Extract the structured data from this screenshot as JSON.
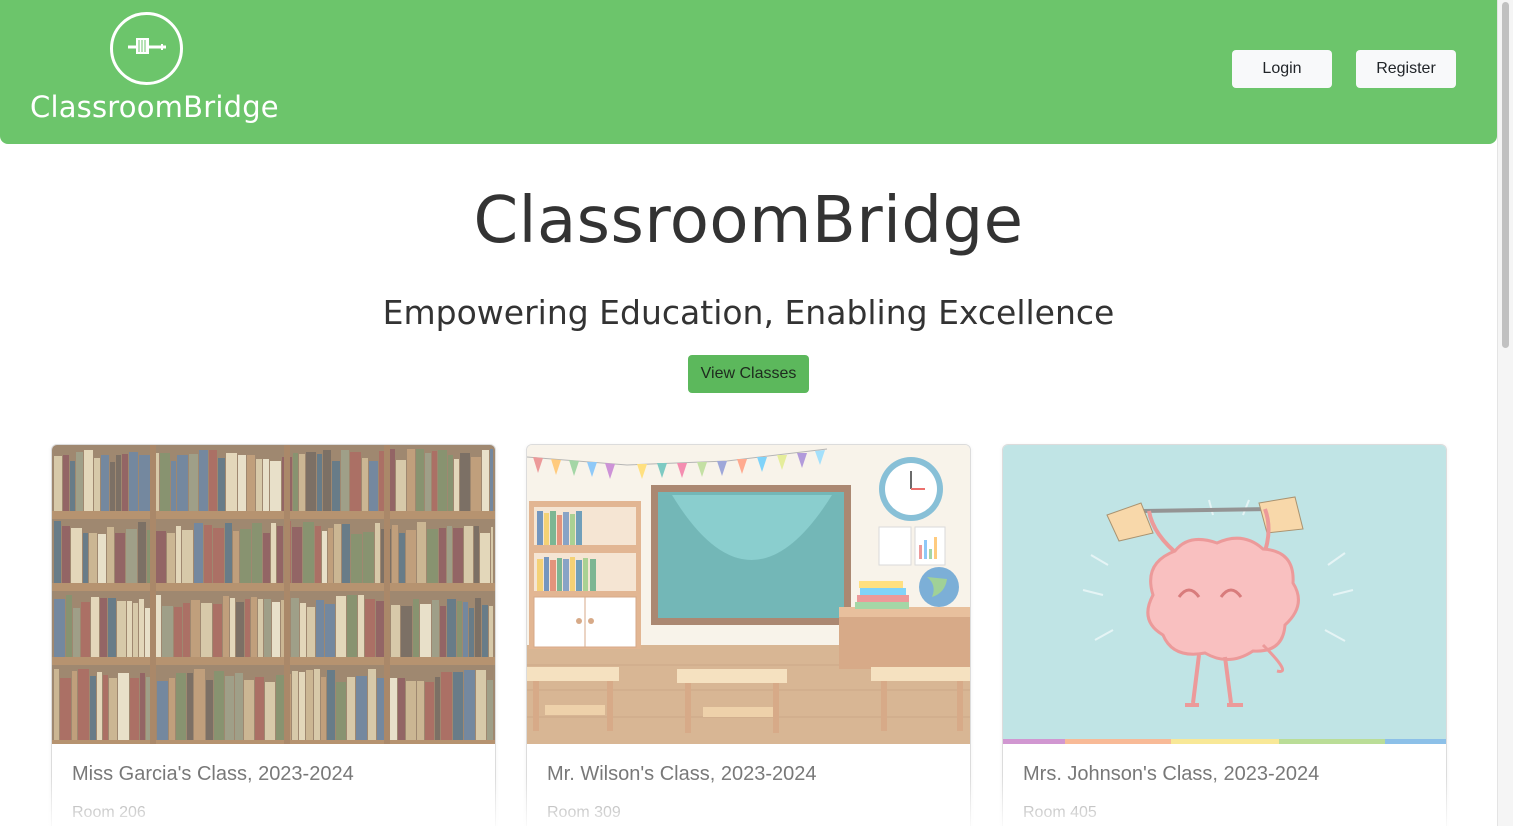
{
  "header": {
    "brand_name": "ClassroomBridge",
    "login_label": "Login",
    "register_label": "Register",
    "background_color": "#6cc56b"
  },
  "hero": {
    "title": "ClassroomBridge",
    "subtitle": "Empowering Education, Enabling Excellence",
    "view_classes_label": "View Classes",
    "button_color": "#5cb85c"
  },
  "classes": [
    {
      "title": "Miss Garcia's Class, 2023-2024",
      "room": "Room 206",
      "image": "bookshelf-image"
    },
    {
      "title": "Mr. Wilson's Class, 2023-2024",
      "room": "Room 309",
      "image": "classroom-image"
    },
    {
      "title": "Mrs. Johnson's Class, 2023-2024",
      "room": "Room 405",
      "image": "brain-weightlifting-image"
    }
  ]
}
